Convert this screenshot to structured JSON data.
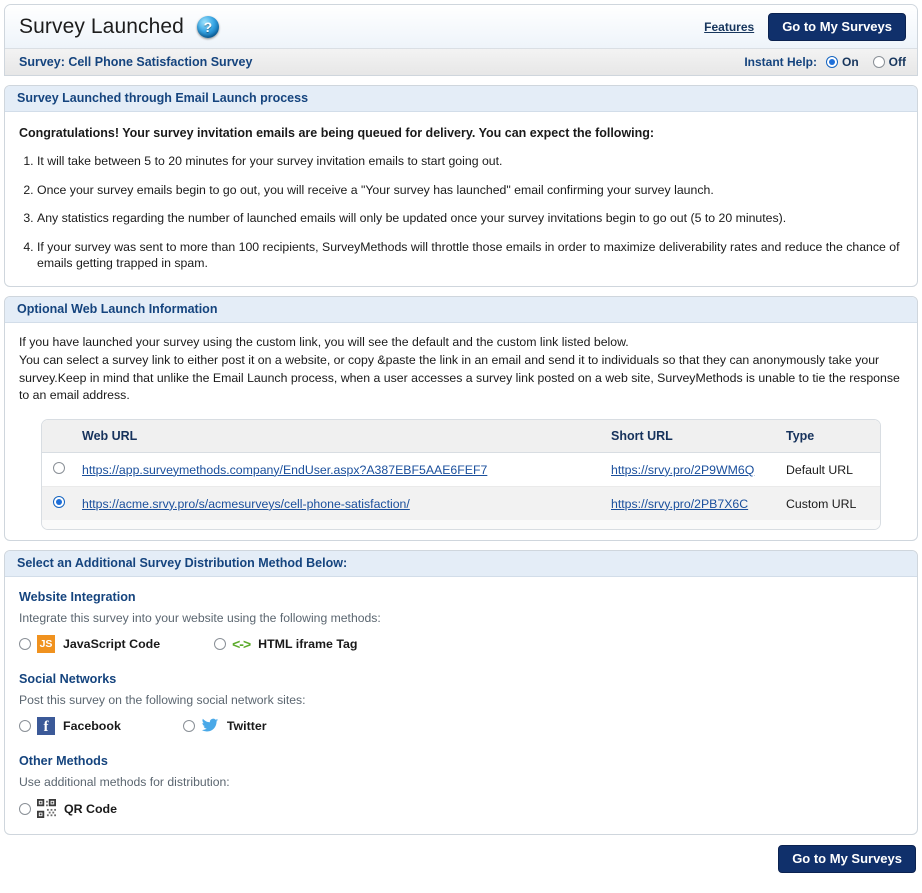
{
  "header": {
    "title": "Survey Launched",
    "help_icon": "help-question-orb-icon",
    "features_label": "Features",
    "go_to_surveys_label": "Go to My Surveys",
    "survey_label": "Survey: Cell Phone Satisfaction Survey",
    "instant_help_label": "Instant Help:",
    "instant_help_on": "On",
    "instant_help_off": "Off",
    "instant_help_value": "On"
  },
  "email_panel": {
    "heading": "Survey Launched through Email Launch process",
    "lead": "Congratulations! Your survey invitation emails are being queued for delivery. You can expect the following:",
    "items": [
      "It will take between 5 to 20 minutes for your survey invitation emails to start going out.",
      "Once your survey emails begin to go out, you will receive a \"Your survey has launched\" email confirming your survey launch.",
      "Any statistics regarding the number of launched emails will only be updated once your survey invitations begin to go out (5 to 20 minutes).",
      "If your survey was sent to more than 100 recipients, SurveyMethods will throttle those emails in order to maximize deliverability rates and reduce the chance of emails getting trapped in spam."
    ]
  },
  "web_panel": {
    "heading": "Optional Web Launch Information",
    "para_line1": "If you have launched your survey using the custom link, you will see the default and the custom link listed below.",
    "para_line2": "You can select a survey link to either post it on a website, or copy &paste the link in an email and send it to individuals so that they can anonymously take your survey.Keep in mind that unlike the Email Launch process, when a user accesses a survey link posted on a web site, SurveyMethods is unable to tie the response to an email address.",
    "table": {
      "columns": [
        "Web URL",
        "Short URL",
        "Type"
      ],
      "rows": [
        {
          "selected": false,
          "web_url": "https://app.surveymethods.company/EndUser.aspx?A387EBF5AAE6FEF7",
          "short_url": "https://srvy.pro/2P9WM6Q",
          "type": "Default URL"
        },
        {
          "selected": true,
          "web_url": "https://acme.srvy.pro/s/acmesurveys/cell-phone-satisfaction/",
          "short_url": "https://srvy.pro/2PB7X6C",
          "type": "Custom URL"
        }
      ]
    }
  },
  "distribution": {
    "heading": "Select an Additional Survey Distribution Method Below:",
    "groups": [
      {
        "title": "Website Integration",
        "subtitle": "Integrate this survey into your website using the following methods:",
        "options": [
          {
            "label": "JavaScript Code",
            "icon": "javascript-icon",
            "icon_text": "JS",
            "selected": false
          },
          {
            "label": "HTML iframe Tag",
            "icon": "iframe-code-icon",
            "icon_text": "<->",
            "selected": false
          }
        ]
      },
      {
        "title": "Social Networks",
        "subtitle": "Post this survey on the following social network sites:",
        "options": [
          {
            "label": "Facebook",
            "icon": "facebook-icon",
            "icon_text": "f",
            "selected": false
          },
          {
            "label": "Twitter",
            "icon": "twitter-bird-icon",
            "icon_text": "",
            "selected": false
          }
        ]
      },
      {
        "title": "Other Methods",
        "subtitle": "Use additional methods for distribution:",
        "options": [
          {
            "label": "QR Code",
            "icon": "qr-code-icon",
            "icon_text": "",
            "selected": false
          }
        ]
      }
    ]
  },
  "footer": {
    "go_to_surveys_label": "Go to My Surveys"
  },
  "colors": {
    "navy_button": "#10306b",
    "section_header_text": "#15447e",
    "section_header_bg": "#e4edf7",
    "link": "#1a4f9c",
    "radio_selected": "#1e6fd9",
    "js_orange": "#f0921f",
    "iframe_green": "#5cab2b",
    "facebook_blue": "#3b5998",
    "twitter_blue": "#4aa9e8"
  }
}
